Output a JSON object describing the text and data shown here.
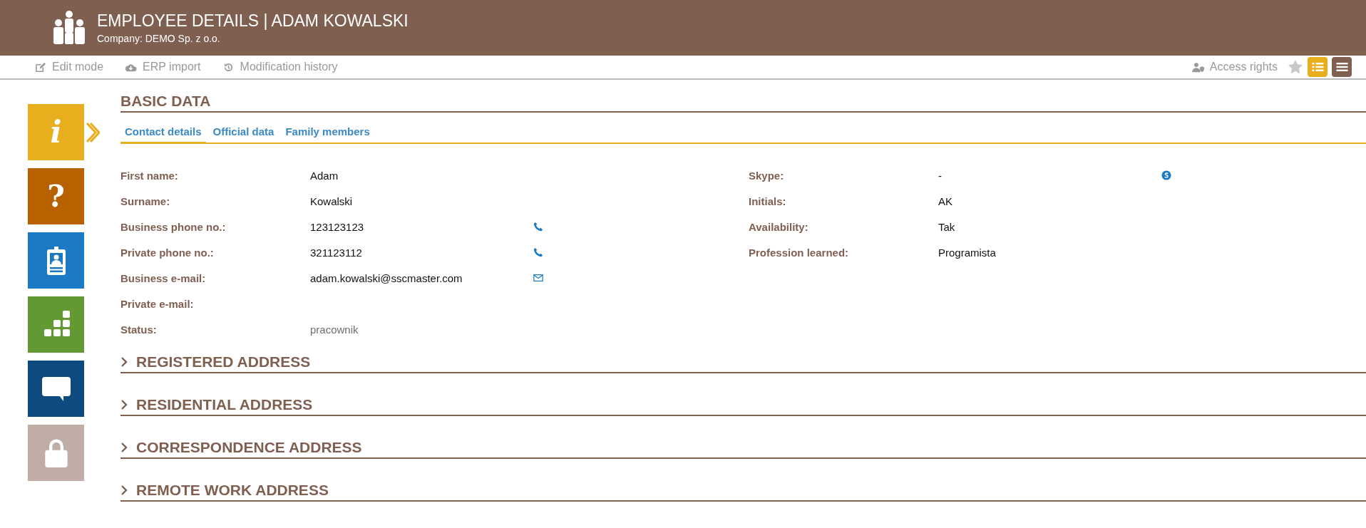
{
  "header": {
    "title": "EMPLOYEE DETAILS | ADAM KOWALSKI",
    "subtitle": "Company: DEMO Sp. z o.o."
  },
  "toolbar": {
    "actions": [
      {
        "kind": "edit",
        "label": "Edit mode"
      },
      {
        "kind": "cloud",
        "label": "ERP import"
      },
      {
        "kind": "history",
        "label": "Modification history"
      }
    ],
    "access_rights": "Access rights",
    "favorite": false,
    "views": [
      {
        "kind": "list",
        "selected": true
      },
      {
        "kind": "menu",
        "selected": false
      }
    ]
  },
  "sidebar": {
    "items": [
      {
        "kind": "info",
        "glyph": "i",
        "color": "#e8ae1e",
        "selected": true
      },
      {
        "kind": "help",
        "glyph": "?",
        "color": "#b86100",
        "selected": false
      },
      {
        "kind": "badge",
        "color": "#1a7ac4",
        "selected": false
      },
      {
        "kind": "blocks",
        "color": "#629933",
        "selected": false
      },
      {
        "kind": "chat",
        "color": "#0d4a80",
        "selected": false
      },
      {
        "kind": "lock",
        "color": "#c0aea6",
        "selected": false
      }
    ]
  },
  "basic_data": {
    "title": "BASIC DATA",
    "tabs": [
      {
        "label": "Contact details",
        "selected": true
      },
      {
        "label": "Official data",
        "selected": false
      },
      {
        "label": "Family members",
        "selected": false
      }
    ],
    "left_fields": [
      {
        "label": "First name:",
        "value": "Adam",
        "kind": "text",
        "readonly": false
      },
      {
        "label": "Surname:",
        "value": "Kowalski",
        "kind": "text",
        "readonly": false
      },
      {
        "label": "Business phone no.:",
        "value": "123123123",
        "kind": "phone",
        "readonly": false
      },
      {
        "label": "Private phone no.:",
        "value": "321123112",
        "kind": "phone",
        "readonly": false
      },
      {
        "label": "Business e-mail:",
        "value": "adam.kowalski@sscmaster.com",
        "kind": "email",
        "readonly": false
      },
      {
        "label": "Private e-mail:",
        "kind": "text"
      },
      {
        "label": "Status:",
        "value": "pracownik",
        "kind": "text",
        "readonly": true
      }
    ],
    "right_fields": [
      {
        "label": "Skype:",
        "value": "-",
        "kind": "skype",
        "readonly": false
      },
      {
        "label": "Initials:",
        "value": "AK",
        "kind": "text",
        "readonly": false
      },
      {
        "label": "Availability:",
        "value": "Tak",
        "kind": "text",
        "readonly": false
      },
      {
        "label": "Profession learned:",
        "value": "Programista",
        "kind": "text",
        "readonly": false
      }
    ]
  },
  "sections": [
    {
      "title": "REGISTERED ADDRESS",
      "expanded": false
    },
    {
      "title": "RESIDENTIAL ADDRESS",
      "expanded": false
    },
    {
      "title": "CORRESPONDENCE ADDRESS",
      "expanded": false
    },
    {
      "title": "REMOTE WORK ADDRESS",
      "expanded": false
    }
  ]
}
